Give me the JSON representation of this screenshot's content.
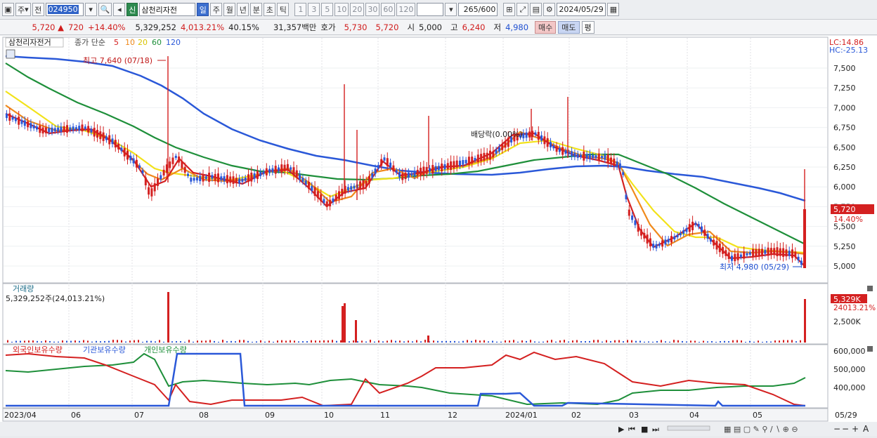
{
  "toolbar": {
    "period_mode": "주",
    "whole_label": "전",
    "stock_code": "024950",
    "credit_badge": "신",
    "stock_name": "삼천리자전",
    "timeframes": [
      "일",
      "주",
      "월",
      "년",
      "분",
      "초",
      "틱"
    ],
    "selected_timeframe": "일",
    "minute_values": [
      "1",
      "3",
      "5",
      "10",
      "20",
      "30",
      "60",
      "120"
    ],
    "bar_count": "265",
    "bar_total": "/600",
    "date": "2024/05/29"
  },
  "quote": {
    "price": "5,720",
    "arrow": "▲",
    "change": "720",
    "change_rate": "+14.40%",
    "volume": "5,329,252",
    "volume_rate": "4,013.21%",
    "turnover": "40.15%",
    "amount": "31,357백만",
    "ask_label": "호가",
    "ask1": "5,730",
    "ask2": "5,720",
    "open_label": "시",
    "open": "5,000",
    "high_label": "고",
    "high": "6,240",
    "low_label": "저",
    "low": "4,980",
    "buy_label": "매수",
    "sell_label": "매도",
    "eval_label": "평"
  },
  "price_panel": {
    "legend_name": "삼천리자전거",
    "legend_type": "종가 단순",
    "ma_periods": [
      "5",
      "10",
      "20",
      "60",
      "120"
    ],
    "ma_colors": [
      "#d42020",
      "#f08a1c",
      "#f2e21a",
      "#1e8f3a",
      "#2a58d8"
    ],
    "lc": "LC:14.86",
    "hc": "HC:-25.13",
    "y_ticks": [
      "7,500",
      "7,250",
      "7,000",
      "6,750",
      "6,500",
      "6,250",
      "6,000",
      "5,750",
      "5,500",
      "5,250",
      "5,000"
    ],
    "price_label": "5,720",
    "price_pct": "14.40%",
    "high_note": "최고 7,640 (07/18)",
    "low_note": "최저 4,980 (05/29)",
    "dividend_note": "배당락(0.00%)"
  },
  "volume_panel": {
    "title": "거래량",
    "value": "5,329,252주(24,013.21%)",
    "y_tick": "2,500K",
    "cur_label": "5,329K",
    "cur_pct": "24013.21%"
  },
  "holdings_panel": {
    "legend": [
      "외국인보유수량",
      "기관보유수량",
      "개인보유수량"
    ],
    "legend_colors": [
      "#d42020",
      "#2a58d8",
      "#1e8f3a"
    ],
    "y_ticks": [
      "600,000",
      "500,000",
      "400,000"
    ]
  },
  "x_axis": {
    "labels": [
      "2023/04",
      "06",
      "07",
      "08",
      "09",
      "10",
      "11",
      "12",
      "2024/01",
      "02",
      "03",
      "04",
      "05"
    ],
    "right_label": "05/29"
  }
}
